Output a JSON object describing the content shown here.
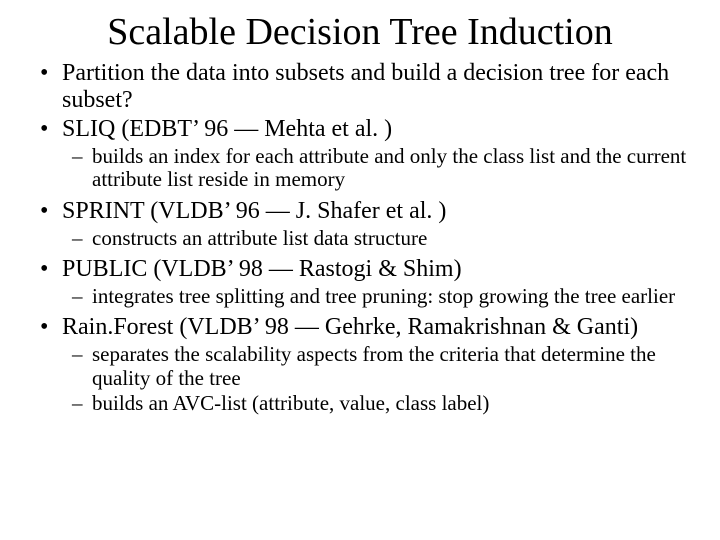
{
  "title": "Scalable Decision Tree Induction",
  "bullets": {
    "b0": "Partition the data into subsets and build a decision tree for each subset?",
    "b1": "SLIQ (EDBT’ 96 — Mehta et al. )",
    "b1_0": "builds an index for each attribute and only the class list and the current attribute list reside in memory",
    "b2": "SPRINT (VLDB’ 96 — J. Shafer et al. )",
    "b2_0": "constructs an attribute list data structure",
    "b3": "PUBLIC (VLDB’ 98 — Rastogi & Shim)",
    "b3_0": "integrates tree splitting and tree pruning: stop growing the tree earlier",
    "b4": "Rain.Forest  (VLDB’ 98 — Gehrke, Ramakrishnan & Ganti)",
    "b4_0": "separates the scalability aspects from the criteria that determine the quality of the tree",
    "b4_1": "builds an AVC-list (attribute, value, class label)"
  }
}
